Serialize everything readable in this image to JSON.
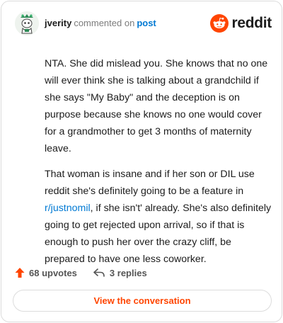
{
  "header": {
    "username": "jverity",
    "verb": "commented on",
    "post_link": "post",
    "brand": "reddit"
  },
  "comment": {
    "p1": "NTA. She did mislead you. She knows that no one will ever think she is talking about a grandchild if she says \"My Baby\" and the deception is on purpose because she knows no one would cover for a grandmother to get 3 months of maternity leave.",
    "p2_before": "That woman is insane and if her son or DIL use reddit she's definitely going to be a feature in ",
    "p2_link": "r/justnomil",
    "p2_after": ", if she isn't' already. She's also definitely going to get rejected upon arrival, so if that is enough to push her over the crazy cliff, be prepared to have one less coworker."
  },
  "actions": {
    "upvotes": "68 upvotes",
    "replies": "3 replies"
  },
  "footer": {
    "button_label": "View the conversation"
  },
  "colors": {
    "accent": "#ff4500",
    "link": "#0079d3"
  },
  "icons": [
    "avatar-snoo-icon",
    "reddit-logo-icon",
    "upvote-arrow-icon",
    "reply-arrow-icon"
  ]
}
